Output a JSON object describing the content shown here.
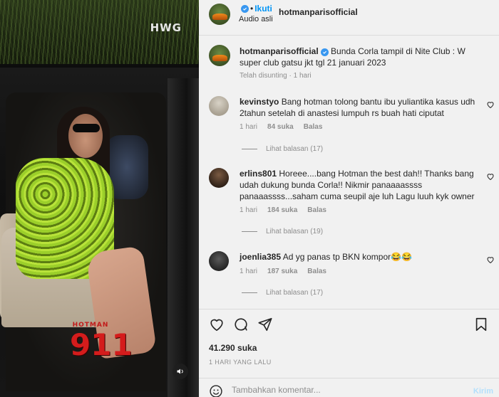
{
  "video": {
    "watermark": "HWG",
    "show_logo_top": "HOTMAN",
    "show_logo_main": "911",
    "audio_icon": "speaker-icon"
  },
  "header": {
    "username": "hotmanparisofficial",
    "follow_label": "Ikuti",
    "separator": "•",
    "audio_label": "Audio asli"
  },
  "caption": {
    "username": "hotmanparisofficial",
    "text": "Bunda Corla tampil di Nite Club : W super club gatsu jkt tgl 21 januari 2023",
    "edited_label": "Telah disunting",
    "separator": "·",
    "time": "1 hari"
  },
  "comments": [
    {
      "username": "kevinstyo",
      "text": "Bang hotman tolong bantu ibu yuliantika kasus udh 2tahun setelah di anastesi lumpuh rs buah hati ciputat",
      "time": "1 hari",
      "likes": "84 suka",
      "reply_label": "Balas",
      "view_replies": "Lihat balasan (17)"
    },
    {
      "username": "erlins801",
      "text": "Horeee....bang Hotman the best dah!! Thanks bang udah dukung bunda Corla!! Nikmir panaaaassss panaaassss...saham cuma seupil aje luh Lagu luuh kyk owner",
      "time": "1 hari",
      "likes": "184 suka",
      "reply_label": "Balas",
      "view_replies": "Lihat balasan (19)"
    },
    {
      "username": "joenlia385",
      "text": "Ad yg panas tp BKN kompor😂😂",
      "time": "1 hari",
      "likes": "187 suka",
      "reply_label": "Balas",
      "view_replies": "Lihat balasan (17)"
    }
  ],
  "actions": {
    "likes": "41.290 suka",
    "date": "1 HARI YANG LALU"
  },
  "add_comment": {
    "placeholder": "Tambahkan komentar...",
    "post_label": "Kirim"
  },
  "colors": {
    "accent": "#0095f6",
    "verified": "#3897f0",
    "muted_text": "#8e8e8e",
    "background": "#f1f1f1"
  }
}
